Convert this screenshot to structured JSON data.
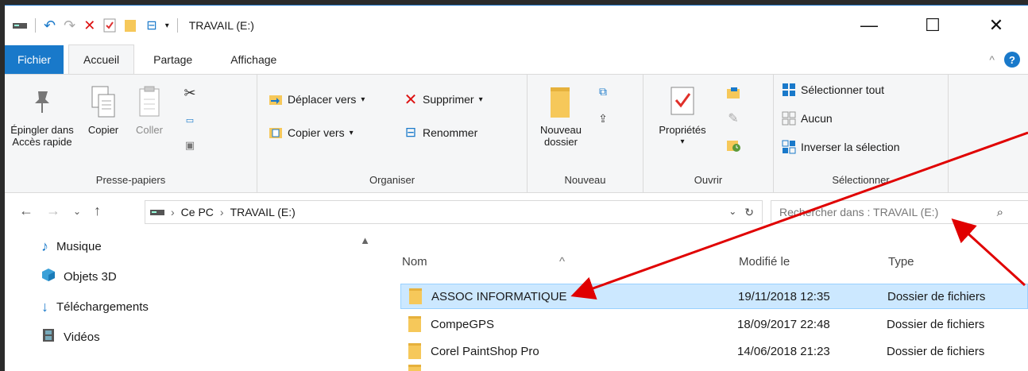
{
  "window": {
    "title": "TRAVAIL (E:)",
    "controls": {
      "minimize": "—",
      "maximize": "☐",
      "close": "✕"
    }
  },
  "tabs": {
    "file": "Fichier",
    "home": "Accueil",
    "share": "Partage",
    "view": "Affichage"
  },
  "ribbon": {
    "clipboard": {
      "label": "Presse-papiers",
      "pin": "Épingler dans Accès rapide",
      "copy": "Copier",
      "paste": "Coller"
    },
    "organize": {
      "label": "Organiser",
      "move_to": "Déplacer vers",
      "copy_to": "Copier vers",
      "delete": "Supprimer",
      "rename": "Renommer"
    },
    "new": {
      "label": "Nouveau",
      "new_folder": "Nouveau dossier"
    },
    "open": {
      "label": "Ouvrir",
      "properties": "Propriétés"
    },
    "select": {
      "label": "Sélectionner",
      "select_all": "Sélectionner tout",
      "none": "Aucun",
      "invert": "Inverser la sélection"
    }
  },
  "address": {
    "crumbs": [
      "Ce PC",
      "TRAVAIL (E:)"
    ],
    "search_placeholder": "Rechercher dans : TRAVAIL (E:)"
  },
  "nav_pane": {
    "items": [
      {
        "label": "Musique",
        "icon": "music-icon"
      },
      {
        "label": "Objets 3D",
        "icon": "cube-icon"
      },
      {
        "label": "Téléchargements",
        "icon": "download-icon"
      },
      {
        "label": "Vidéos",
        "icon": "video-icon"
      }
    ]
  },
  "file_list": {
    "columns": {
      "name": "Nom",
      "modified": "Modifié le",
      "type": "Type"
    },
    "rows": [
      {
        "name": "ASSOC INFORMATIQUE",
        "modified": "19/11/2018 12:35",
        "type": "Dossier de fichiers",
        "selected": true
      },
      {
        "name": "CompeGPS",
        "modified": "18/09/2017 22:48",
        "type": "Dossier de fichiers"
      },
      {
        "name": "Corel PaintShop Pro",
        "modified": "14/06/2018 21:23",
        "type": "Dossier de fichiers"
      }
    ]
  },
  "colors": {
    "accent": "#1979ca",
    "selection": "#cce8ff",
    "annotation": "#e00000"
  }
}
